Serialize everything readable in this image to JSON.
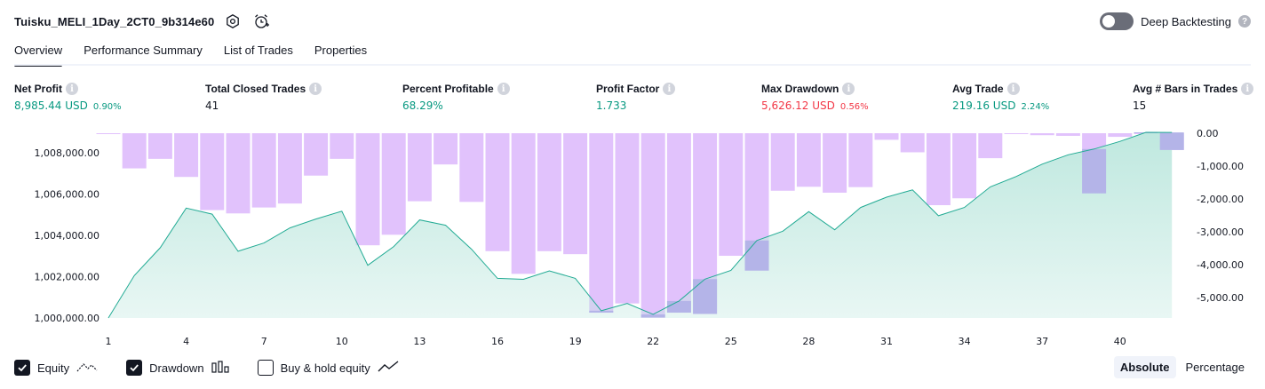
{
  "header": {
    "strategy_title": "Tuisku_MELI_1Day_2CT0_9b314e60",
    "settings_icon": "hexagon-gear-icon",
    "alert_icon": "alarm-clock-plus-icon",
    "deep_backtesting_label": "Deep Backtesting",
    "deep_backtesting_on": false
  },
  "tabs": [
    {
      "label": "Overview",
      "active": true
    },
    {
      "label": "Performance Summary",
      "active": false
    },
    {
      "label": "List of Trades",
      "active": false
    },
    {
      "label": "Properties",
      "active": false
    }
  ],
  "metrics": {
    "net_profit": {
      "label": "Net Profit",
      "value": "8,985.44 USD",
      "pct": "0.90%"
    },
    "total_closed_trades": {
      "label": "Total Closed Trades",
      "value": "41"
    },
    "percent_profitable": {
      "label": "Percent Profitable",
      "value": "68.29%"
    },
    "profit_factor": {
      "label": "Profit Factor",
      "value": "1.733"
    },
    "max_drawdown": {
      "label": "Max Drawdown",
      "value": "5,626.12 USD",
      "pct": "0.56%"
    },
    "avg_trade": {
      "label": "Avg Trade",
      "value": "219.16 USD",
      "pct": "2.24%"
    },
    "avg_bars": {
      "label": "Avg # Bars in Trades",
      "value": "15"
    }
  },
  "colors": {
    "positive": "#089981",
    "negative": "#f23645",
    "drawdown_bar": "#e1c2fc",
    "drawdown_overlap": "#b4b4e8",
    "equity_line": "#22ab94",
    "equity_fill_top": "#bfe8df"
  },
  "chart_data": {
    "type": "area",
    "x_ticks": [
      "1",
      "4",
      "7",
      "10",
      "13",
      "16",
      "19",
      "22",
      "25",
      "28",
      "31",
      "34",
      "37",
      "40"
    ],
    "left_axis_ticks": [
      "1,000,000.00",
      "1,002,000.00",
      "1,004,000.00",
      "1,006,000.00",
      "1,008,000.00"
    ],
    "right_axis_ticks": [
      "0.00",
      "-1,000.00",
      "-2,000.00",
      "-3,000.00",
      "-4,000.00",
      "-5,000.00"
    ],
    "equity_ylim": [
      1000000,
      1009000
    ],
    "drawdown_ylim": [
      -5626,
      0
    ],
    "x_range": [
      1,
      42
    ],
    "series": [
      {
        "name": "Equity",
        "type": "line",
        "x": [
          1,
          2,
          3,
          4,
          5,
          6,
          7,
          8,
          9,
          10,
          11,
          12,
          13,
          14,
          15,
          16,
          17,
          18,
          19,
          20,
          21,
          22,
          23,
          24,
          25,
          26,
          27,
          28,
          29,
          30,
          31,
          32,
          33,
          34,
          35,
          36,
          37,
          38,
          39,
          40,
          41,
          42
        ],
        "values": [
          1000000,
          1002050,
          1003400,
          1005320,
          1005030,
          1003230,
          1003630,
          1004360,
          1004790,
          1005170,
          1002550,
          1003460,
          1004750,
          1004490,
          1003330,
          1001920,
          1001870,
          1002280,
          1001920,
          1000350,
          1000700,
          1000170,
          1000820,
          1001880,
          1002300,
          1003750,
          1004200,
          1005150,
          1004270,
          1005350,
          1005850,
          1006200,
          1004950,
          1005350,
          1006350,
          1006850,
          1007450,
          1007900,
          1008180,
          1008550,
          1008990,
          1008985
        ]
      },
      {
        "name": "Drawdown",
        "type": "bar",
        "x": [
          1,
          2,
          3,
          4,
          5,
          6,
          7,
          8,
          9,
          10,
          11,
          12,
          13,
          14,
          15,
          16,
          17,
          18,
          19,
          20,
          21,
          22,
          23,
          24,
          25,
          26,
          27,
          28,
          29,
          30,
          31,
          32,
          33,
          34,
          35,
          36,
          37,
          38,
          39,
          40,
          41,
          42
        ],
        "values": [
          0,
          -1070,
          -780,
          -1330,
          -2340,
          -2440,
          -2260,
          -2140,
          -1290,
          -780,
          -3410,
          -3090,
          -2070,
          -950,
          -2090,
          -3590,
          -4280,
          -3590,
          -3680,
          -5460,
          -5180,
          -5610,
          -5460,
          -5500,
          -3730,
          -4180,
          -1750,
          -1630,
          -1810,
          -1640,
          -200,
          -580,
          -2190,
          -1980,
          -760,
          0,
          -60,
          -80,
          -1830,
          -110,
          0,
          -510
        ]
      }
    ]
  },
  "legend": {
    "items": [
      {
        "label": "Equity",
        "checked": true,
        "icon": "line-chart-icon"
      },
      {
        "label": "Drawdown",
        "checked": true,
        "icon": "bar-chart-icon"
      },
      {
        "label": "Buy & hold equity",
        "checked": false,
        "icon": "trend-line-icon"
      }
    ],
    "scale_options": [
      {
        "label": "Absolute",
        "active": true
      },
      {
        "label": "Percentage",
        "active": false
      }
    ]
  }
}
